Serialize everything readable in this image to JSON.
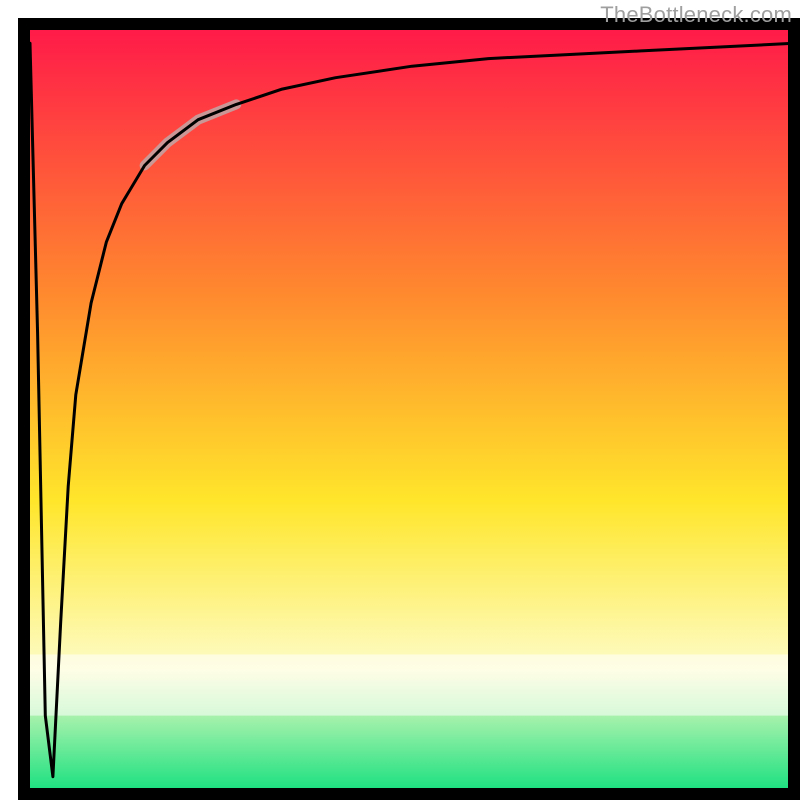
{
  "watermark_text": "TheBottleneck.com",
  "colors": {
    "gradient_top": "#ff1a49",
    "gradient_mid_high": "#ff8a2e",
    "gradient_mid": "#ffe62b",
    "gradient_low": "#fdfcc7",
    "gradient_bottom": "#18e07f",
    "curve": "#000000",
    "highlight": "#c1a6a6",
    "axis": "#000000",
    "watermark": "#9f9f9f"
  },
  "chart_data": {
    "type": "line",
    "title": "",
    "xlabel": "",
    "ylabel": "",
    "xlim": [
      0,
      100
    ],
    "ylim": [
      0,
      100
    ],
    "x": [
      0,
      1,
      2,
      3,
      4,
      5,
      6,
      8,
      10,
      12,
      15,
      18,
      22,
      27,
      33,
      40,
      50,
      60,
      70,
      80,
      90,
      100
    ],
    "series": [
      {
        "name": "bottleneck-curve",
        "values": [
          98,
          60,
          10,
          2,
          22,
          40,
          52,
          64,
          72,
          77,
          82,
          85,
          88,
          90,
          92,
          93.5,
          95,
          96,
          96.5,
          97,
          97.5,
          98
        ]
      }
    ],
    "highlight_segment": {
      "x_start": 15,
      "x_end": 27
    },
    "minimum": {
      "x": 3,
      "y": 2
    },
    "fade_band_y": [
      10,
      18
    ]
  }
}
